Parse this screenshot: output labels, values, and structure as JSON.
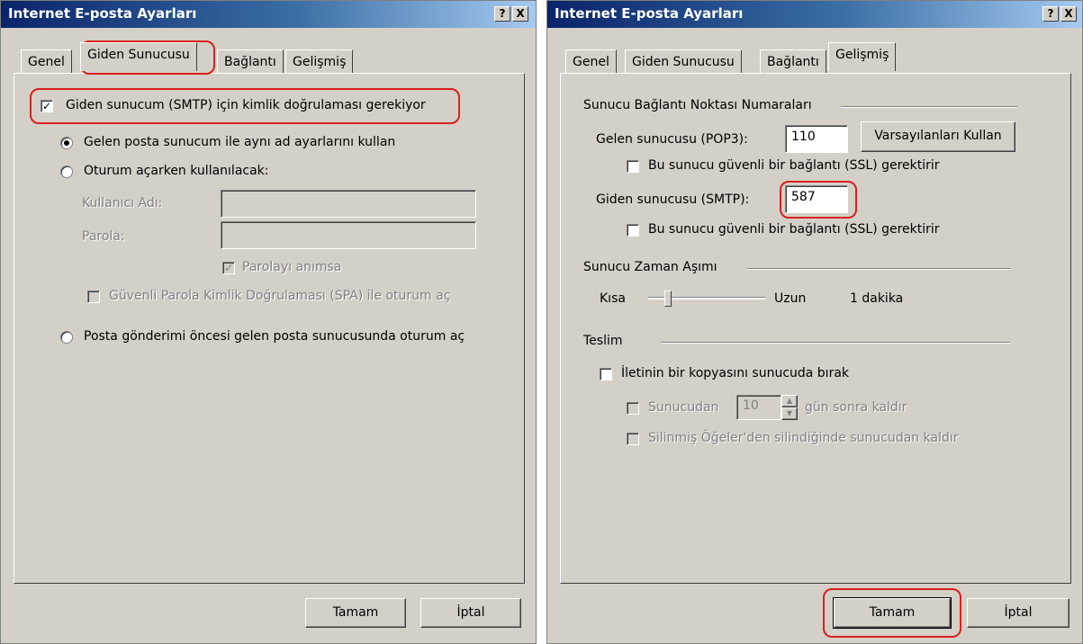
{
  "left": {
    "title": "Internet E-posta Ayarları",
    "help_btn": "?",
    "close_btn": "X",
    "tabs": [
      "Genel",
      "Giden Sunucusu",
      "Bağlantı",
      "Gelişmiş"
    ],
    "auth_required": "Giden sunucum (SMTP) için kimlik doğrulaması gerekiyor",
    "auth_checked": true,
    "radio_same": "Gelen posta sunucum ile aynı ad ayarlarını kullan",
    "radio_logon": "Oturum açarken kullanılacak:",
    "username_label": "Kullanıcı Adı:",
    "password_label": "Parola:",
    "username_value": "",
    "password_value": "",
    "remember_password": "Parolayı anımsa",
    "spa": "Güvenli Parola Kimlik Doğrulaması (SPA) ile oturum aç",
    "radio_before": "Posta gönderimi öncesi gelen posta sunucusunda oturum aç",
    "ok": "Tamam",
    "cancel": "İptal"
  },
  "right": {
    "title": "Internet E-posta Ayarları",
    "help_btn": "?",
    "close_btn": "X",
    "tabs": [
      "Genel",
      "Giden Sunucusu",
      "Bağlantı",
      "Gelişmiş"
    ],
    "group_ports": "Sunucu Bağlantı Noktası Numaraları",
    "incoming_label": "Gelen sunucusu (POP3):",
    "incoming_value": "110",
    "use_defaults": "Varsayılanları Kullan",
    "ssl_incoming": "Bu sunucu güvenli bir bağlantı (SSL) gerektirir",
    "outgoing_label": "Giden sunucusu (SMTP):",
    "outgoing_value": "587",
    "ssl_outgoing": "Bu sunucu güvenli bir bağlantı (SSL) gerektirir",
    "group_timeout": "Sunucu Zaman Aşımı",
    "short": "Kısa",
    "long": "Uzun",
    "timeout_value": "1 dakika",
    "timeout_level": 0.15,
    "group_delivery": "Teslim",
    "leave_copy": "İletinin bir kopyasını sunucuda bırak",
    "remove_after_prefix": "Sunucudan",
    "remove_days": "10",
    "remove_after_suffix": "gün sonra kaldır",
    "remove_deleted": "Silinmiş Öğeler'den silindiğinde sunucudan kaldır",
    "ok": "Tamam",
    "cancel": "İptal"
  },
  "colors": {
    "highlight": "#d9201f",
    "titlebar": "#0a246a",
    "face": "#d4d0c8"
  }
}
